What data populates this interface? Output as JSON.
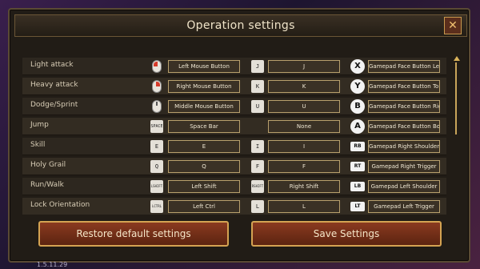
{
  "window": {
    "title": "Operation settings",
    "close_icon": "✕"
  },
  "rows": [
    {
      "action": "Light attack",
      "key1": "mouse-left",
      "bind1": "Left Mouse Button",
      "key2": "J",
      "bind2": "J",
      "pad": "X",
      "bind3": "Gamepad Face Button Left"
    },
    {
      "action": "Heavy attack",
      "key1": "mouse-right",
      "bind1": "Right Mouse Button",
      "key2": "K",
      "bind2": "K",
      "pad": "Y",
      "bind3": "Gamepad Face Button Top"
    },
    {
      "action": "Dodge/Sprint",
      "key1": "mouse-middle",
      "bind1": "Middle Mouse Button",
      "key2": "U",
      "bind2": "U",
      "pad": "B",
      "bind3": "Gamepad Face Button Right"
    },
    {
      "action": "Jump",
      "key1": "SPACE",
      "bind1": "Space Bar",
      "key2": "",
      "bind2": "None",
      "pad": "A",
      "bind3": "Gamepad Face Button Bottom"
    },
    {
      "action": "Skill",
      "key1": "E",
      "bind1": "E",
      "key2": "I",
      "bind2": "I",
      "pad": "RB",
      "bind3": "Gamepad Right Shoulder"
    },
    {
      "action": "Holy Grail",
      "key1": "Q",
      "bind1": "Q",
      "key2": "F",
      "bind2": "F",
      "pad": "RT",
      "bind3": "Gamepad Right Trigger"
    },
    {
      "action": "Run/Walk",
      "key1": "LSHIFT",
      "bind1": "Left Shift",
      "key2": "RSHIFT",
      "bind2": "Right Shift",
      "pad": "LB",
      "bind3": "Gamepad Left Shoulder"
    },
    {
      "action": "Lock Orientation",
      "key1": "LCTRL",
      "bind1": "Left Ctrl",
      "key2": "L",
      "bind2": "L",
      "pad": "LT",
      "bind3": "Gamepad Left Trigger"
    }
  ],
  "footer": {
    "restore_label": "Restore default settings",
    "save_label": "Save Settings",
    "version": "1.5.11.29"
  }
}
